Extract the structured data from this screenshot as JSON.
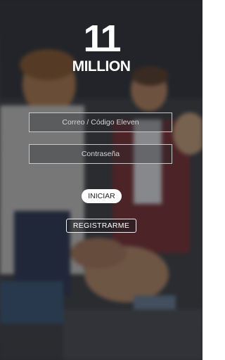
{
  "logo": {
    "number": "11",
    "word": "MILLION"
  },
  "form": {
    "email_placeholder": "Correo / Código Eleven",
    "password_placeholder": "Contraseña",
    "login_label": "INICIAR",
    "register_label": "REGISTRARME"
  }
}
